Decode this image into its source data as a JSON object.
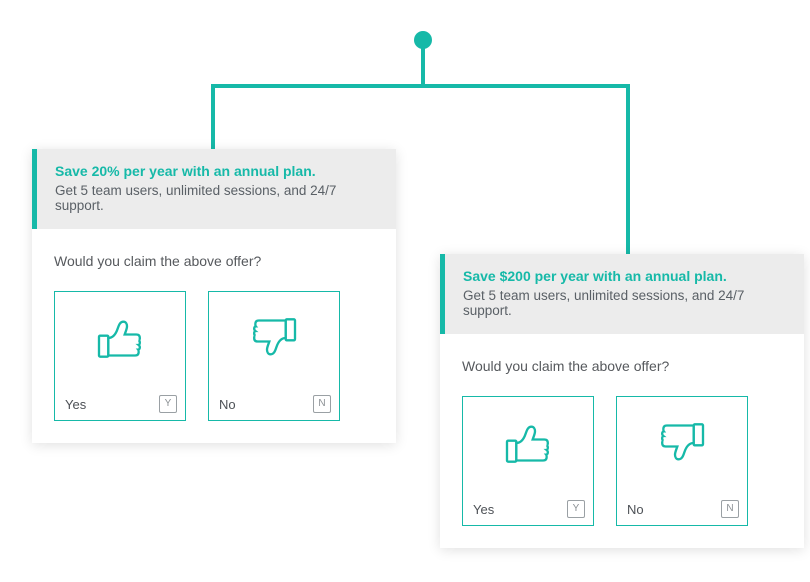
{
  "accent": "#16b9a8",
  "variants": [
    {
      "headline": "Save 20% per year with an annual plan.",
      "subtext": "Get 5 team users, unlimited sessions, and 24/7 support.",
      "question": "Would you claim the above offer?",
      "yes_label": "Yes",
      "yes_key": "Y",
      "no_label": "No",
      "no_key": "N"
    },
    {
      "headline": "Save $200 per year with an annual plan.",
      "subtext": "Get 5 team users, unlimited sessions, and 24/7 support.",
      "question": "Would you claim the above offer?",
      "yes_label": "Yes",
      "yes_key": "Y",
      "no_label": "No",
      "no_key": "N"
    }
  ]
}
